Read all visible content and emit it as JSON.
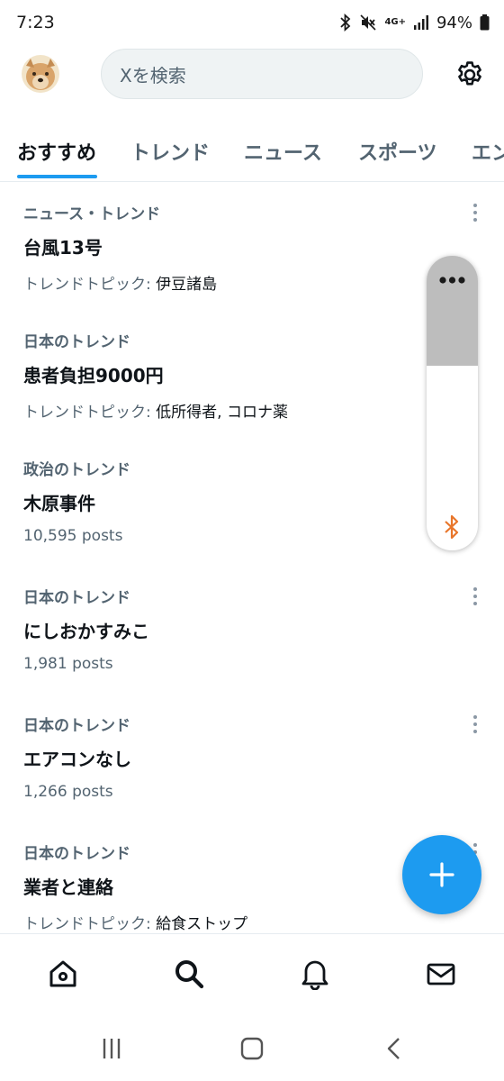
{
  "status_bar": {
    "time": "7:23",
    "network": "4G+",
    "battery": "94%"
  },
  "header": {
    "avatar_icon": "dog-avatar",
    "search_placeholder": "Xを検索",
    "settings_icon": "gear-icon"
  },
  "tabs": [
    {
      "label": "おすすめ",
      "active": true
    },
    {
      "label": "トレンド",
      "active": false
    },
    {
      "label": "ニュース",
      "active": false
    },
    {
      "label": "スポーツ",
      "active": false
    },
    {
      "label": "エン",
      "active": false
    }
  ],
  "trends": [
    {
      "context": "ニュース・トレンド",
      "title": "台風13号",
      "meta_prefix": "トレンドトピック: ",
      "meta": "伊豆諸島"
    },
    {
      "context": "日本のトレンド",
      "title": "患者負担9000円",
      "meta_prefix": "トレンドトピック: ",
      "meta": "低所得者, コロナ薬"
    },
    {
      "context": "政治のトレンド",
      "title": "木原事件",
      "meta_prefix": "",
      "meta": "10,595 posts"
    },
    {
      "context": "日本のトレンド",
      "title": "にしおかすみこ",
      "meta_prefix": "",
      "meta": "1,981 posts"
    },
    {
      "context": "日本のトレンド",
      "title": "エアコンなし",
      "meta_prefix": "",
      "meta": "1,266 posts"
    },
    {
      "context": "日本のトレンド",
      "title": "業者と連絡",
      "meta_prefix": "トレンドトピック: ",
      "meta": "給食ストップ"
    }
  ],
  "fab": {
    "icon": "plus-icon"
  },
  "bottom_nav": [
    "home-icon",
    "search-icon",
    "bell-icon",
    "mail-icon"
  ],
  "colors": {
    "accent": "#1d9bf0",
    "text": "#0f1419",
    "secondary": "#536471",
    "bluetooth": "#e8762b"
  }
}
